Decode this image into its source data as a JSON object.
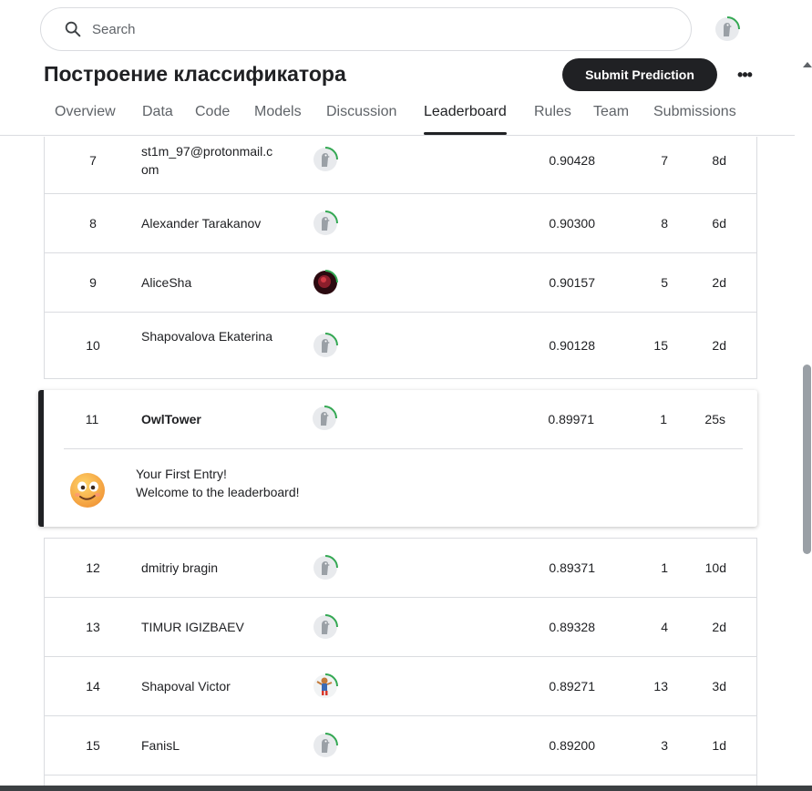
{
  "search": {
    "placeholder": "Search"
  },
  "competition": {
    "title": "Построение классификатора",
    "submit_label": "Submit Prediction",
    "more_label": "•••"
  },
  "tabs": [
    {
      "label": "Overview"
    },
    {
      "label": "Data"
    },
    {
      "label": "Code"
    },
    {
      "label": "Models"
    },
    {
      "label": "Discussion"
    },
    {
      "label": "Leaderboard",
      "active": true
    },
    {
      "label": "Rules"
    },
    {
      "label": "Team"
    },
    {
      "label": "Submissions"
    }
  ],
  "leaderboard": {
    "rows_above": [
      {
        "rank": "7",
        "name": "st1m_97@protonmail.com",
        "avatar": "default-avatar-icon",
        "score": "0.90428",
        "entries": "7",
        "last": "8d"
      },
      {
        "rank": "8",
        "name": "Alexander Tarakanov",
        "avatar": "default-avatar-icon",
        "score": "0.90300",
        "entries": "8",
        "last": "6d"
      },
      {
        "rank": "9",
        "name": "AliceSha",
        "avatar": "photo-avatar-icon",
        "score": "0.90157",
        "entries": "5",
        "last": "2d"
      },
      {
        "rank": "10",
        "name": "Shapovalova Ekaterina",
        "avatar": "default-avatar-icon",
        "score": "0.90128",
        "entries": "15",
        "last": "2d"
      }
    ],
    "own_entry": {
      "rank": "11",
      "name": "OwlTower",
      "avatar": "default-avatar-icon",
      "score": "0.89971",
      "entries": "1",
      "last": "25s",
      "message_line1": "Your First Entry!",
      "message_line2": "Welcome to the leaderboard!"
    },
    "rows_below": [
      {
        "rank": "12",
        "name": "dmitriy bragin",
        "avatar": "default-avatar-icon",
        "score": "0.89371",
        "entries": "1",
        "last": "10d"
      },
      {
        "rank": "13",
        "name": "TIMUR IGIZBAEV",
        "avatar": "default-avatar-icon",
        "score": "0.89328",
        "entries": "4",
        "last": "2d"
      },
      {
        "rank": "14",
        "name": "Shapoval Victor",
        "avatar": "character-avatar-icon",
        "score": "0.89271",
        "entries": "13",
        "last": "3d"
      },
      {
        "rank": "15",
        "name": "FanisL",
        "avatar": "default-avatar-icon",
        "score": "0.89200",
        "entries": "3",
        "last": "1d"
      }
    ]
  },
  "colors": {
    "accent": "#202124",
    "progress_ring": "#20beff",
    "ring_green": "#34a853",
    "border": "#dadce0"
  }
}
